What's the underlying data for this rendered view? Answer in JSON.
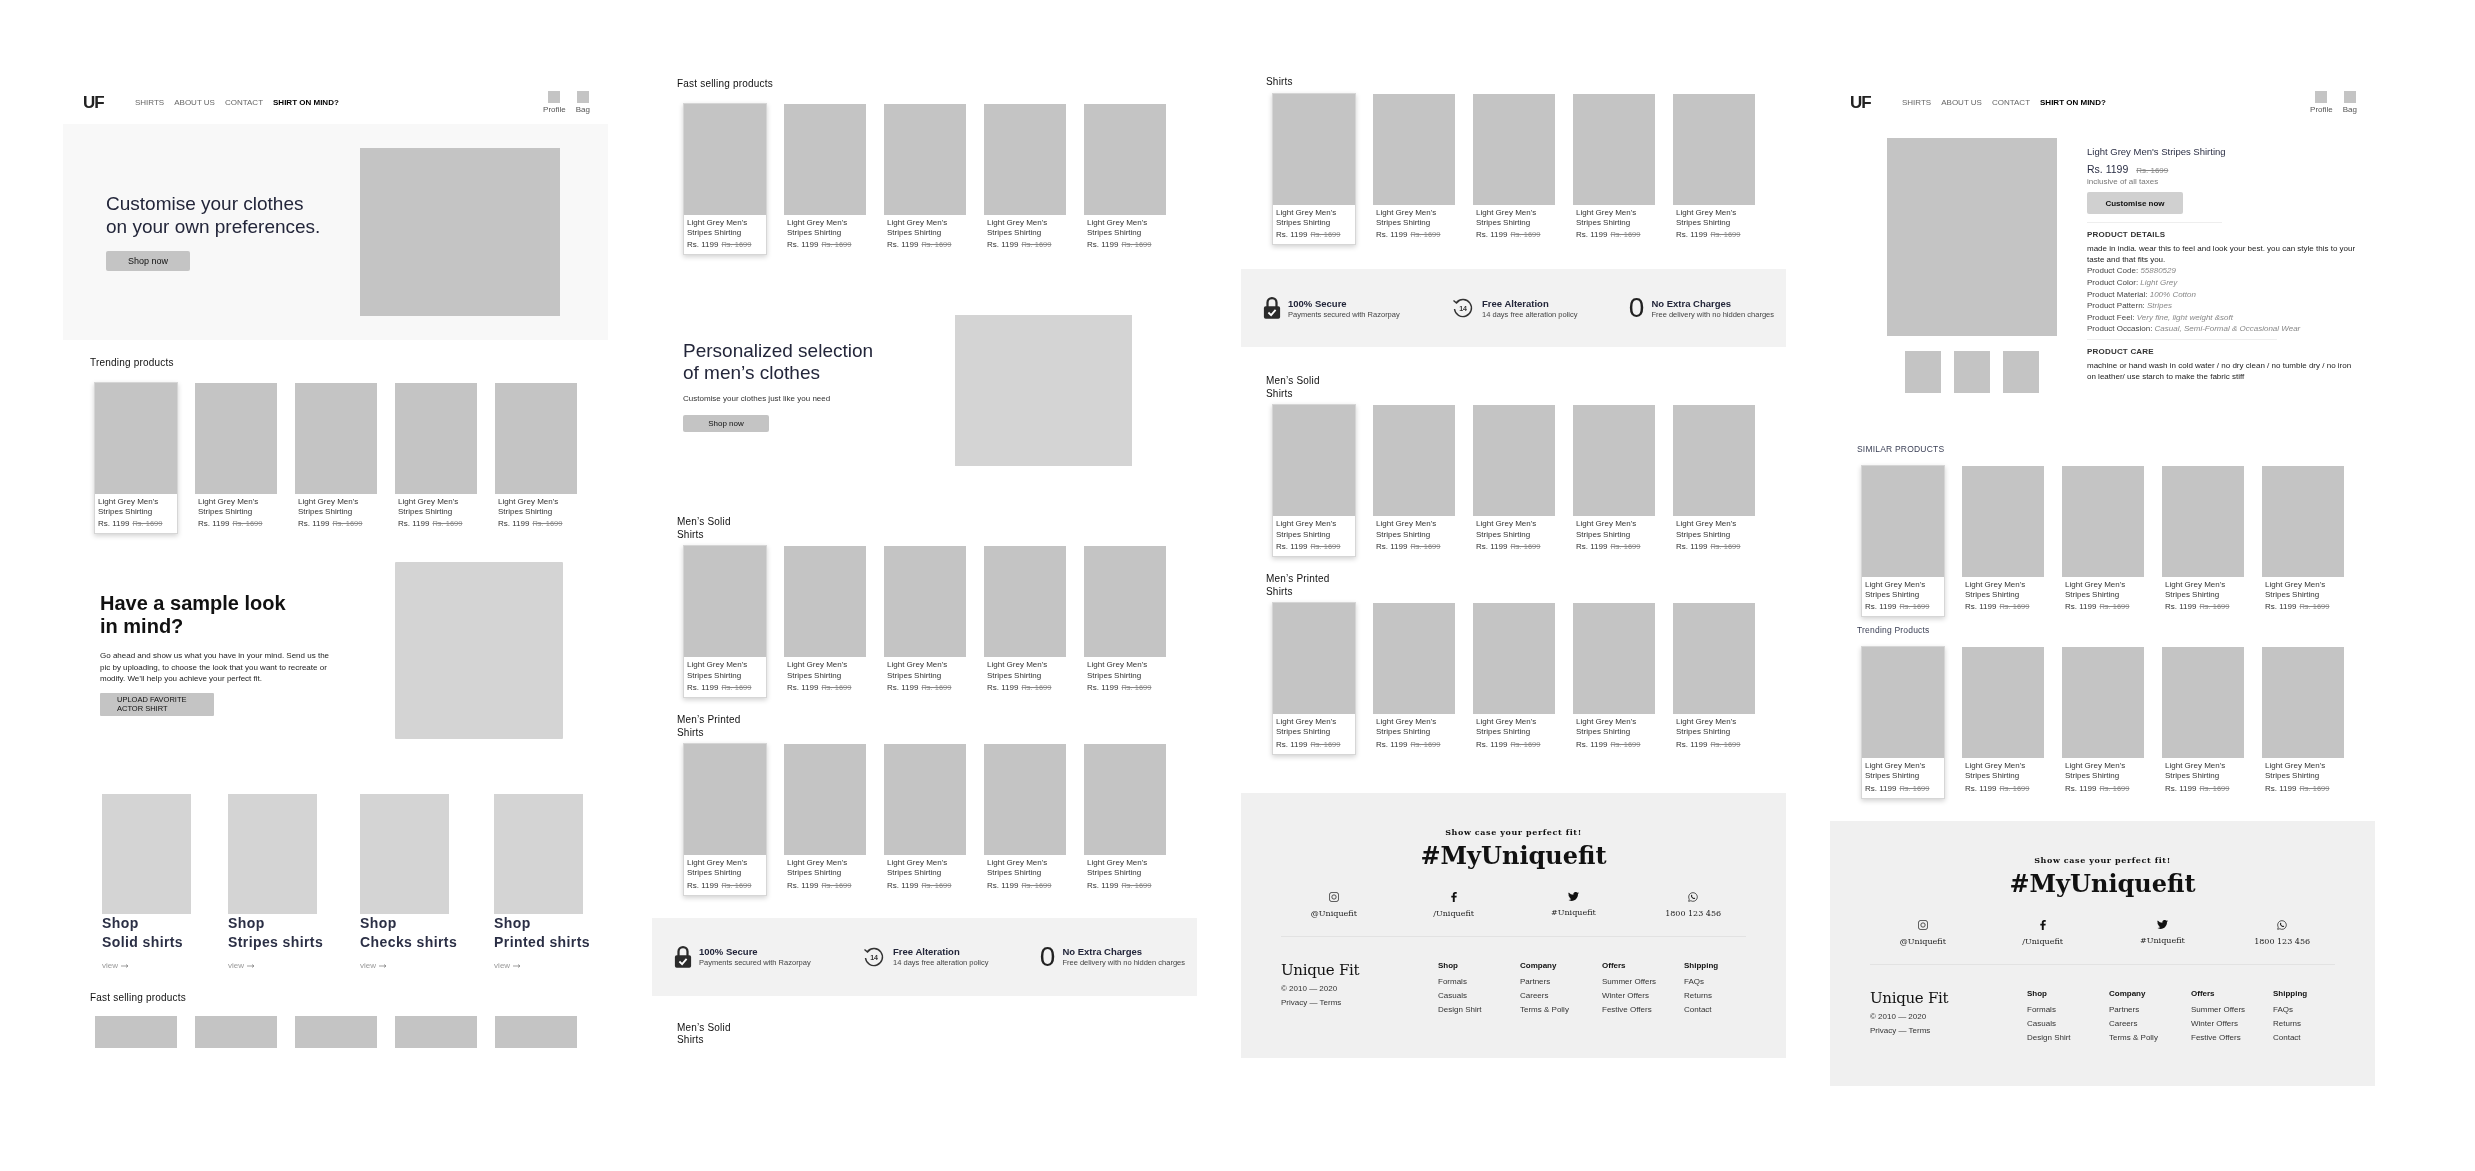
{
  "boards": [
    {
      "sections": [
        {
          "kind": "header",
          "logo": "UF",
          "nav": [
            {
              "label": "SHIRTS",
              "selected": false
            },
            {
              "label": "ABOUT US",
              "selected": false
            },
            {
              "label": "CONTACT",
              "selected": false
            },
            {
              "label": "SHIRT ON MIND?",
              "selected": true
            }
          ],
          "actions": [
            {
              "label": "Profile"
            },
            {
              "label": "Bag"
            }
          ]
        },
        {
          "kind": "hero",
          "title": "Customise your clothes\non your own preferences.",
          "button": "Shop now"
        },
        {
          "kind": "heading",
          "text": "Trending products"
        },
        {
          "kind": "products",
          "cards": [
            {
              "name": "Light Grey Men's Stripes Shirting",
              "price": "Rs. 1199",
              "old_price": "Rs. 1699",
              "highlighted": true
            },
            {
              "name": "Light Grey Men's Stripes Shirting",
              "price": "Rs. 1199",
              "old_price": "Rs. 1699",
              "highlighted": false
            },
            {
              "name": "Light Grey Men's Stripes Shirting",
              "price": "Rs. 1199",
              "old_price": "Rs. 1699",
              "highlighted": false
            },
            {
              "name": "Light Grey Men's Stripes Shirting",
              "price": "Rs. 1199",
              "old_price": "Rs. 1699",
              "highlighted": false
            },
            {
              "name": "Light Grey Men's Stripes Shirting",
              "price": "Rs. 1199",
              "old_price": "Rs. 1699",
              "highlighted": false
            }
          ]
        },
        {
          "kind": "sample",
          "title": "Have a sample look\nin mind?",
          "text": "Go ahead and show us what you have in your mind. Send us the pic by uploading, to choose the look that you want to recreate or modify. We’ll help you achieve your perfect fit.",
          "button": "UPLOAD FAVORITE ACTOR SHIRT"
        },
        {
          "kind": "categories",
          "items": [
            {
              "kicker": "Shop",
              "title": "Solid shirts",
              "link": "view"
            },
            {
              "kicker": "Shop",
              "title": "Stripes shirts",
              "link": "view"
            },
            {
              "kicker": "Shop",
              "title": "Checks shirts",
              "link": "view"
            },
            {
              "kicker": "Shop",
              "title": "Printed shirts",
              "link": "view"
            }
          ]
        },
        {
          "kind": "heading",
          "text": "Fast selling  products"
        },
        {
          "kind": "products_cut",
          "cards": [
            {
              "kind": "picture"
            },
            {
              "kind": "picture"
            },
            {
              "kind": "picture"
            },
            {
              "kind": "picture"
            },
            {
              "kind": "picture"
            }
          ]
        }
      ]
    },
    {
      "sections": [
        {
          "kind": "heading",
          "text": "Fast selling  products"
        },
        {
          "kind": "products",
          "cards": [
            {
              "name": "Light Grey Men's Stripes Shirting",
              "price": "Rs. 1199",
              "old_price": "Rs. 1699",
              "highlighted": true
            },
            {
              "name": "Light Grey Men's Stripes Shirting",
              "price": "Rs. 1199",
              "old_price": "Rs. 1699",
              "highlighted": false
            },
            {
              "name": "Light Grey Men's Stripes Shirting",
              "price": "Rs. 1199",
              "old_price": "Rs. 1699",
              "highlighted": false
            },
            {
              "name": "Light Grey Men's Stripes Shirting",
              "price": "Rs. 1199",
              "old_price": "Rs. 1699",
              "highlighted": false
            },
            {
              "name": "Light Grey Men's Stripes Shirting",
              "price": "Rs. 1199",
              "old_price": "Rs. 1699",
              "highlighted": false
            }
          ]
        },
        {
          "kind": "promo",
          "title": "Personalized selection\nof men’s clothes",
          "text": "Customise your clothes just like you need",
          "button": "Shop now"
        },
        {
          "kind": "heading",
          "text": "Men’s Solid\nShirts"
        },
        {
          "kind": "products",
          "cards": [
            {
              "name": "Light Grey Men's Stripes Shirting",
              "price": "Rs. 1199",
              "old_price": "Rs. 1699",
              "highlighted": true
            },
            {
              "name": "Light Grey Men's Stripes Shirting",
              "price": "Rs. 1199",
              "old_price": "Rs. 1699",
              "highlighted": false
            },
            {
              "name": "Light Grey Men's Stripes Shirting",
              "price": "Rs. 1199",
              "old_price": "Rs. 1699",
              "highlighted": false
            },
            {
              "name": "Light Grey Men's Stripes Shirting",
              "price": "Rs. 1199",
              "old_price": "Rs. 1699",
              "highlighted": false
            },
            {
              "name": "Light Grey Men's Stripes Shirting",
              "price": "Rs. 1199",
              "old_price": "Rs. 1699",
              "highlighted": false
            }
          ]
        },
        {
          "kind": "heading",
          "text": "Men’s Printed\nShirts"
        },
        {
          "kind": "products",
          "cards": [
            {
              "name": "Light Grey Men's Stripes Shirting",
              "price": "Rs. 1199",
              "old_price": "Rs. 1699",
              "highlighted": true
            },
            {
              "name": "Light Grey Men's Stripes Shirting",
              "price": "Rs. 1199",
              "old_price": "Rs. 1699",
              "highlighted": false
            },
            {
              "name": "Light Grey Men's Stripes Shirting",
              "price": "Rs. 1199",
              "old_price": "Rs. 1699",
              "highlighted": false
            },
            {
              "name": "Light Grey Men's Stripes Shirting",
              "price": "Rs. 1199",
              "old_price": "Rs. 1699",
              "highlighted": false
            },
            {
              "name": "Light Grey Men's Stripes Shirting",
              "price": "Rs. 1199",
              "old_price": "Rs. 1699",
              "highlighted": false
            }
          ]
        },
        {
          "kind": "features",
          "items": [
            {
              "kind": "lock",
              "title": "100% Secure",
              "text": "Payments secured with Razorpay"
            },
            {
              "kind": "alteration",
              "badge": "14",
              "title": "Free Alteration",
              "text": "14 days free alteration policy"
            },
            {
              "kind": "numeral",
              "numeral": "0",
              "title": "No Extra Charges",
              "text": "Free delivery with no hidden charges"
            }
          ]
        },
        {
          "kind": "heading",
          "text": "Men’s Solid\nShirts"
        }
      ]
    },
    {
      "sections": [
        {
          "kind": "heading",
          "text": "Shirts"
        },
        {
          "kind": "products",
          "cards": [
            {
              "name": "Light Grey Men's Stripes Shirting",
              "price": "Rs. 1199",
              "old_price": "Rs. 1699",
              "highlighted": true
            },
            {
              "name": "Light Grey Men's Stripes Shirting",
              "price": "Rs. 1199",
              "old_price": "Rs. 1699",
              "highlighted": false
            },
            {
              "name": "Light Grey Men's Stripes Shirting",
              "price": "Rs. 1199",
              "old_price": "Rs. 1699",
              "highlighted": false
            },
            {
              "name": "Light Grey Men's Stripes Shirting",
              "price": "Rs. 1199",
              "old_price": "Rs. 1699",
              "highlighted": false
            },
            {
              "name": "Light Grey Men's Stripes Shirting",
              "price": "Rs. 1199",
              "old_price": "Rs. 1699",
              "highlighted": false
            }
          ]
        },
        {
          "kind": "features",
          "items": [
            {
              "kind": "lock",
              "title": "100% Secure",
              "text": "Payments secured with Razorpay"
            },
            {
              "kind": "alteration",
              "badge": "14",
              "title": "Free Alteration",
              "text": "14 days free alteration policy"
            },
            {
              "kind": "numeral",
              "numeral": "0",
              "title": "No Extra Charges",
              "text": "Free delivery with no hidden charges"
            }
          ]
        },
        {
          "kind": "heading",
          "text": "Men’s Solid\nShirts"
        },
        {
          "kind": "products",
          "cards": [
            {
              "name": "Light Grey Men's Stripes Shirting",
              "price": "Rs. 1199",
              "old_price": "Rs. 1699",
              "highlighted": true
            },
            {
              "name": "Light Grey Men's Stripes Shirting",
              "price": "Rs. 1199",
              "old_price": "Rs. 1699",
              "highlighted": false
            },
            {
              "name": "Light Grey Men's Stripes Shirting",
              "price": "Rs. 1199",
              "old_price": "Rs. 1699",
              "highlighted": false
            },
            {
              "name": "Light Grey Men's Stripes Shirting",
              "price": "Rs. 1199",
              "old_price": "Rs. 1699",
              "highlighted": false
            },
            {
              "name": "Light Grey Men's Stripes Shirting",
              "price": "Rs. 1199",
              "old_price": "Rs. 1699",
              "highlighted": false
            }
          ]
        },
        {
          "kind": "heading",
          "text": "Men’s Printed\nShirts"
        },
        {
          "kind": "products",
          "cards": [
            {
              "name": "Light Grey Men's Stripes Shirting",
              "price": "Rs. 1199",
              "old_price": "Rs. 1699",
              "highlighted": true
            },
            {
              "name": "Light Grey Men's Stripes Shirting",
              "price": "Rs. 1199",
              "old_price": "Rs. 1699",
              "highlighted": false
            },
            {
              "name": "Light Grey Men's Stripes Shirting",
              "price": "Rs. 1199",
              "old_price": "Rs. 1699",
              "highlighted": false
            },
            {
              "name": "Light Grey Men's Stripes Shirting",
              "price": "Rs. 1199",
              "old_price": "Rs. 1699",
              "highlighted": false
            },
            {
              "name": "Light Grey Men's Stripes Shirting",
              "price": "Rs. 1199",
              "old_price": "Rs. 1699",
              "highlighted": false
            }
          ]
        },
        {
          "kind": "footer",
          "tagline": "Show case your perfect fit!",
          "hashtag": "#MyUniquefit",
          "socials": [
            {
              "kind": "instagram",
              "handle": "@Uniquefit"
            },
            {
              "kind": "facebook",
              "handle": "/Uniquefit"
            },
            {
              "kind": "twitter",
              "handle": "#Uniquefit"
            },
            {
              "kind": "whatsapp",
              "handle": "1800 123 456"
            }
          ],
          "logo": "Unique Fit",
          "copyright": "© 2010 — 2020",
          "legal": "Privacy — Terms",
          "columns": [
            {
              "title": "Shop",
              "links": [
                "Formals",
                "Casuals",
                "Design Shirt"
              ]
            },
            {
              "title": "Company",
              "links": [
                "Partners",
                "Careers",
                "Terms & Polly"
              ]
            },
            {
              "title": "Offers",
              "links": [
                "Summer Offers",
                "Winter Offers",
                "Festive Offers"
              ]
            },
            {
              "title": "Shipping",
              "links": [
                "FAQs",
                "Returns",
                "Contact"
              ]
            }
          ]
        }
      ]
    },
    {
      "sections": [
        {
          "kind": "header",
          "logo": "UF",
          "nav": [
            {
              "label": "SHIRTS",
              "selected": false
            },
            {
              "label": "ABOUT US",
              "selected": false
            },
            {
              "label": "CONTACT",
              "selected": false
            },
            {
              "label": "SHIRT ON MIND?",
              "selected": true
            }
          ],
          "actions": [
            {
              "label": "Profile"
            },
            {
              "label": "Bag"
            }
          ]
        },
        {
          "kind": "detail",
          "thumbnails": [
            {
              "kind": "picture"
            },
            {
              "kind": "picture"
            },
            {
              "kind": "picture"
            }
          ],
          "title": "Light Grey Men's Stripes Shirting",
          "price": "Rs. 1199",
          "old_price": "Rs. 1699",
          "tax_note": "inclusive of all taxes",
          "button": "Customise now",
          "details_heading": "PRODUCT DETAILS",
          "description": "made in india. wear this to feel and look your best. you can style this to your taste and that fits you.",
          "specs": [
            {
              "label": "Product Code:",
              "value": "55880529"
            },
            {
              "label": "Product Color:",
              "value": "Light Grey"
            },
            {
              "label": "Product Material:",
              "value": "100% Cotton"
            },
            {
              "label": "Product Pattern:",
              "value": "Stripes"
            },
            {
              "label": "Product Feel:",
              "value": "Very fine, light weight &soft"
            },
            {
              "label": "Product Occasion:",
              "value": "Casual, Semi-Formal & Occasional Wear"
            }
          ],
          "care_heading": "PRODUCT CARE",
          "care": "machine or hand wash in cold water / no dry clean / no tumble dry / no iron on leather/ use starch to make the fabric stiff"
        },
        {
          "kind": "heading",
          "text": "SIMILAR PRODUCTS"
        },
        {
          "kind": "products",
          "cards": [
            {
              "name": "Light Grey Men's Stripes Shirting",
              "price": "Rs. 1199",
              "old_price": "Rs. 1699",
              "highlighted": true
            },
            {
              "name": "Light Grey Men's Stripes Shirting",
              "price": "Rs. 1199",
              "old_price": "Rs. 1699",
              "highlighted": false
            },
            {
              "name": "Light Grey Men's Stripes Shirting",
              "price": "Rs. 1199",
              "old_price": "Rs. 1699",
              "highlighted": false
            },
            {
              "name": "Light Grey Men's Stripes Shirting",
              "price": "Rs. 1199",
              "old_price": "Rs. 1699",
              "highlighted": false
            },
            {
              "name": "Light Grey Men's Stripes Shirting",
              "price": "Rs. 1199",
              "old_price": "Rs. 1699",
              "highlighted": false
            }
          ]
        },
        {
          "kind": "heading",
          "text": "Trending Products"
        },
        {
          "kind": "products",
          "cards": [
            {
              "name": "Light Grey Men's Stripes Shirting",
              "price": "Rs. 1199",
              "old_price": "Rs. 1699",
              "highlighted": true
            },
            {
              "name": "Light Grey Men's Stripes Shirting",
              "price": "Rs. 1199",
              "old_price": "Rs. 1699",
              "highlighted": false
            },
            {
              "name": "Light Grey Men's Stripes Shirting",
              "price": "Rs. 1199",
              "old_price": "Rs. 1699",
              "highlighted": false
            },
            {
              "name": "Light Grey Men's Stripes Shirting",
              "price": "Rs. 1199",
              "old_price": "Rs. 1699",
              "highlighted": false
            },
            {
              "name": "Light Grey Men's Stripes Shirting",
              "price": "Rs. 1199",
              "old_price": "Rs. 1699",
              "highlighted": false
            }
          ]
        },
        {
          "kind": "footer",
          "tagline": "Show case your perfect fit!",
          "hashtag": "#MyUniquefit",
          "socials": [
            {
              "kind": "instagram",
              "handle": "@Uniquefit"
            },
            {
              "kind": "facebook",
              "handle": "/Uniquefit"
            },
            {
              "kind": "twitter",
              "handle": "#Uniquefit"
            },
            {
              "kind": "whatsapp",
              "handle": "1800 123 456"
            }
          ],
          "logo": "Unique Fit",
          "copyright": "© 2010 — 2020",
          "legal": "Privacy — Terms",
          "columns": [
            {
              "title": "Shop",
              "links": [
                "Formals",
                "Casuals",
                "Design Shirt"
              ]
            },
            {
              "title": "Company",
              "links": [
                "Partners",
                "Careers",
                "Terms & Polly"
              ]
            },
            {
              "title": "Offers",
              "links": [
                "Summer Offers",
                "Winter Offers",
                "Festive Offers"
              ]
            },
            {
              "title": "Shipping",
              "links": [
                "FAQs",
                "Returns",
                "Contact"
              ]
            }
          ]
        }
      ]
    }
  ]
}
